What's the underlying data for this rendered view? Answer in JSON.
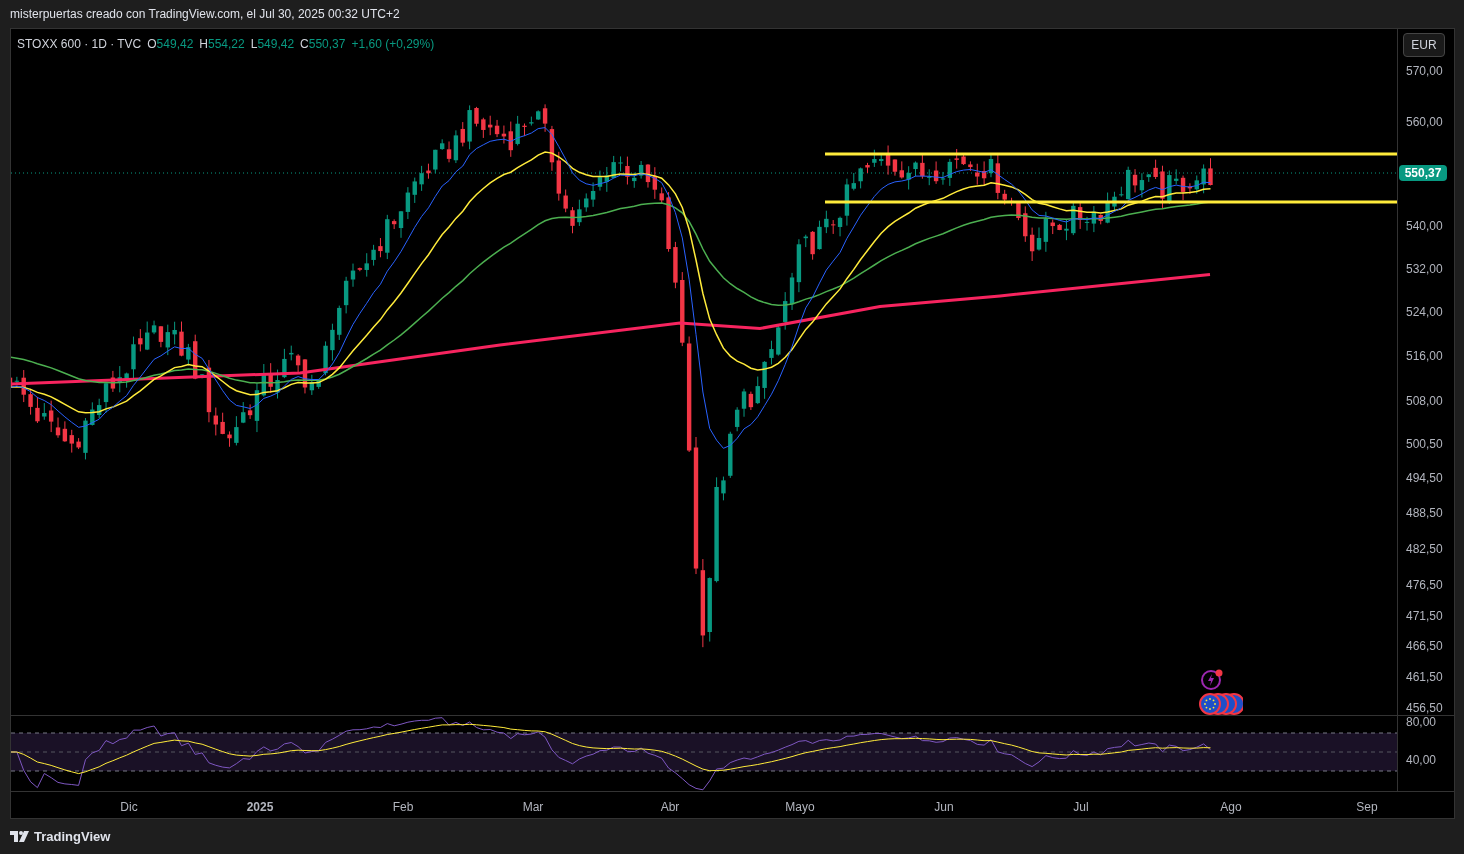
{
  "header": {
    "caption": "misterpuertas creado con TradingView.com, el Jul 30, 2025 00:32 UTC+2"
  },
  "legend": {
    "symbol": "STOXX 600 · 1D · TVC",
    "values": [
      {
        "label": "O",
        "value": "549,42"
      },
      {
        "label": "H",
        "value": "554,22"
      },
      {
        "label": "L",
        "value": "549,42"
      },
      {
        "label": "C",
        "value": "550,37"
      }
    ],
    "change": "+1,60 (+0,29%)"
  },
  "currency_button": "EUR",
  "price_axis": {
    "ticks": [
      "570,00",
      "560,00",
      "540,00",
      "532,00",
      "524,00",
      "516,00",
      "508,00",
      "500,50",
      "494,50",
      "488,50",
      "482,50",
      "476,50",
      "471,50",
      "466,50",
      "461,50",
      "456,50"
    ],
    "last_price": "550,37"
  },
  "rsi_axis": {
    "ticks": [
      "80,00",
      "40,00"
    ]
  },
  "time_axis": {
    "labels": [
      {
        "text": "Dic",
        "bold": false
      },
      {
        "text": "2025",
        "bold": true
      },
      {
        "text": "Feb",
        "bold": false
      },
      {
        "text": "Mar",
        "bold": false
      },
      {
        "text": "Abr",
        "bold": false
      },
      {
        "text": "Mayo",
        "bold": false
      },
      {
        "text": "Jun",
        "bold": false
      },
      {
        "text": "Jul",
        "bold": false
      },
      {
        "text": "Ago",
        "bold": false
      },
      {
        "text": "Sep",
        "bold": false
      }
    ]
  },
  "footer": {
    "logo_text": "TradingView"
  }
}
